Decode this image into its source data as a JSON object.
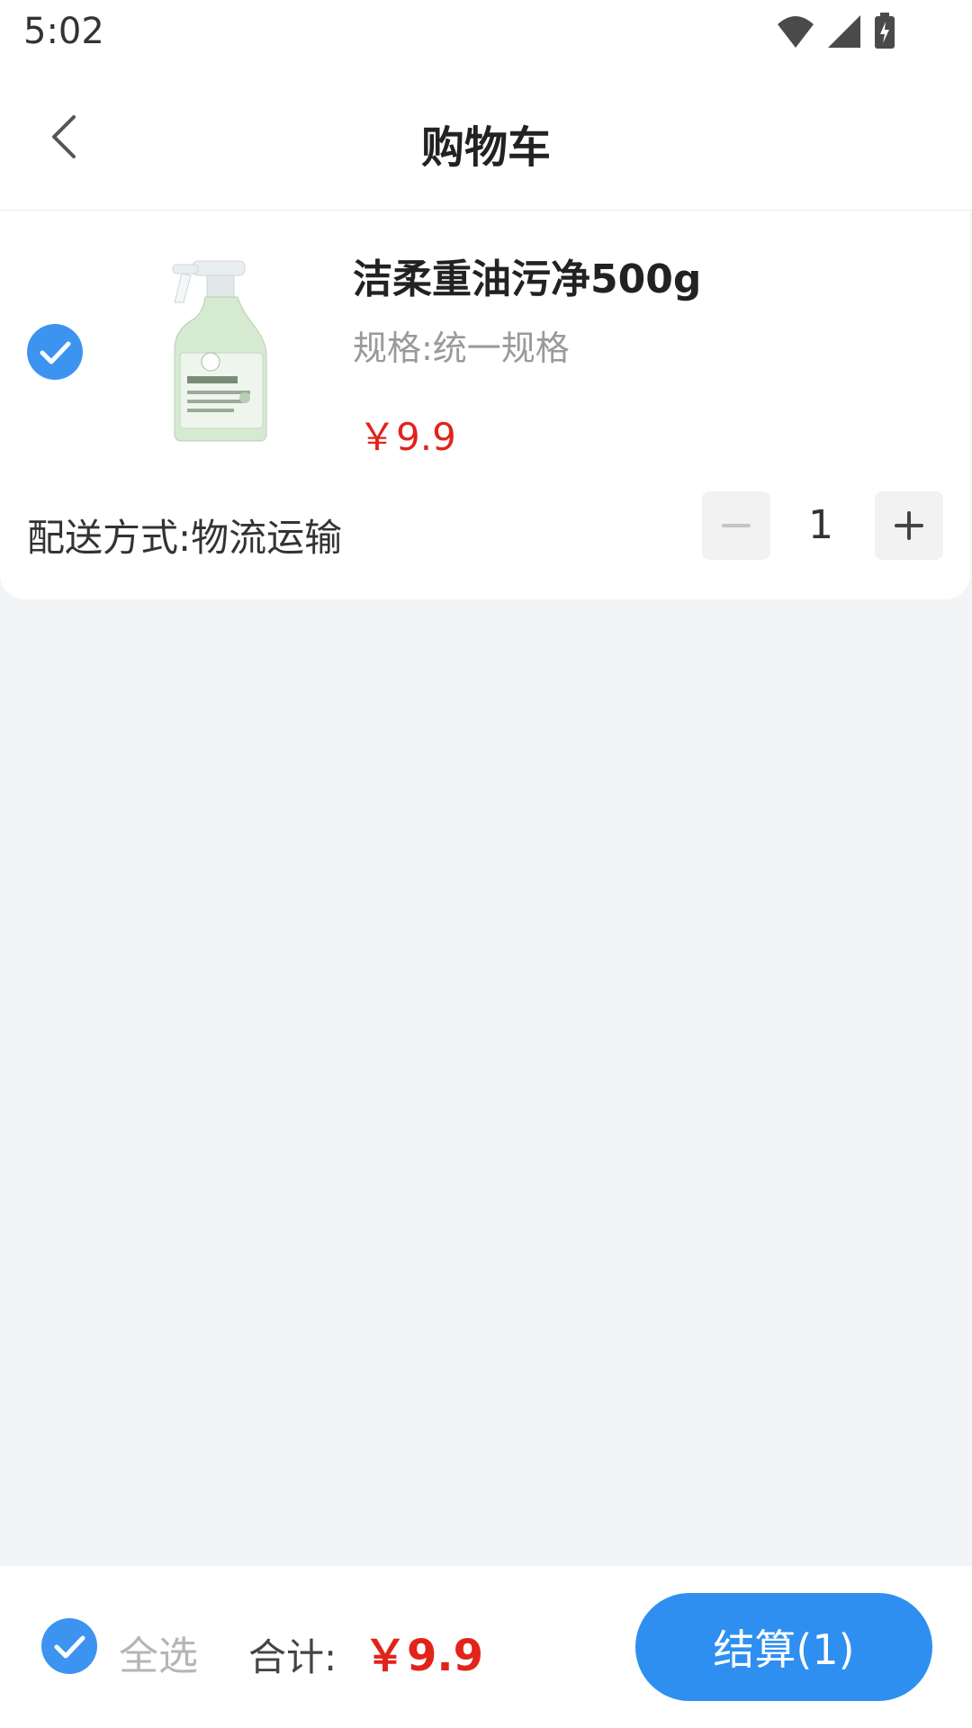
{
  "status_bar": {
    "time": "5:02"
  },
  "header": {
    "title": "购物车"
  },
  "cart_item": {
    "name": "洁柔重油污净500g",
    "spec": "规格:统一规格",
    "price": "￥9.9",
    "delivery": "配送方式:物流运输",
    "quantity": "1",
    "selected": true
  },
  "footer": {
    "select_all_label": "全选",
    "total_label": "合计:",
    "total_value": "￥9.9",
    "checkout_label": "结算(1)"
  },
  "colors": {
    "accent_blue": "#2e8ff0",
    "price_red": "#e2231a",
    "page_bg": "#f3f4f6"
  }
}
